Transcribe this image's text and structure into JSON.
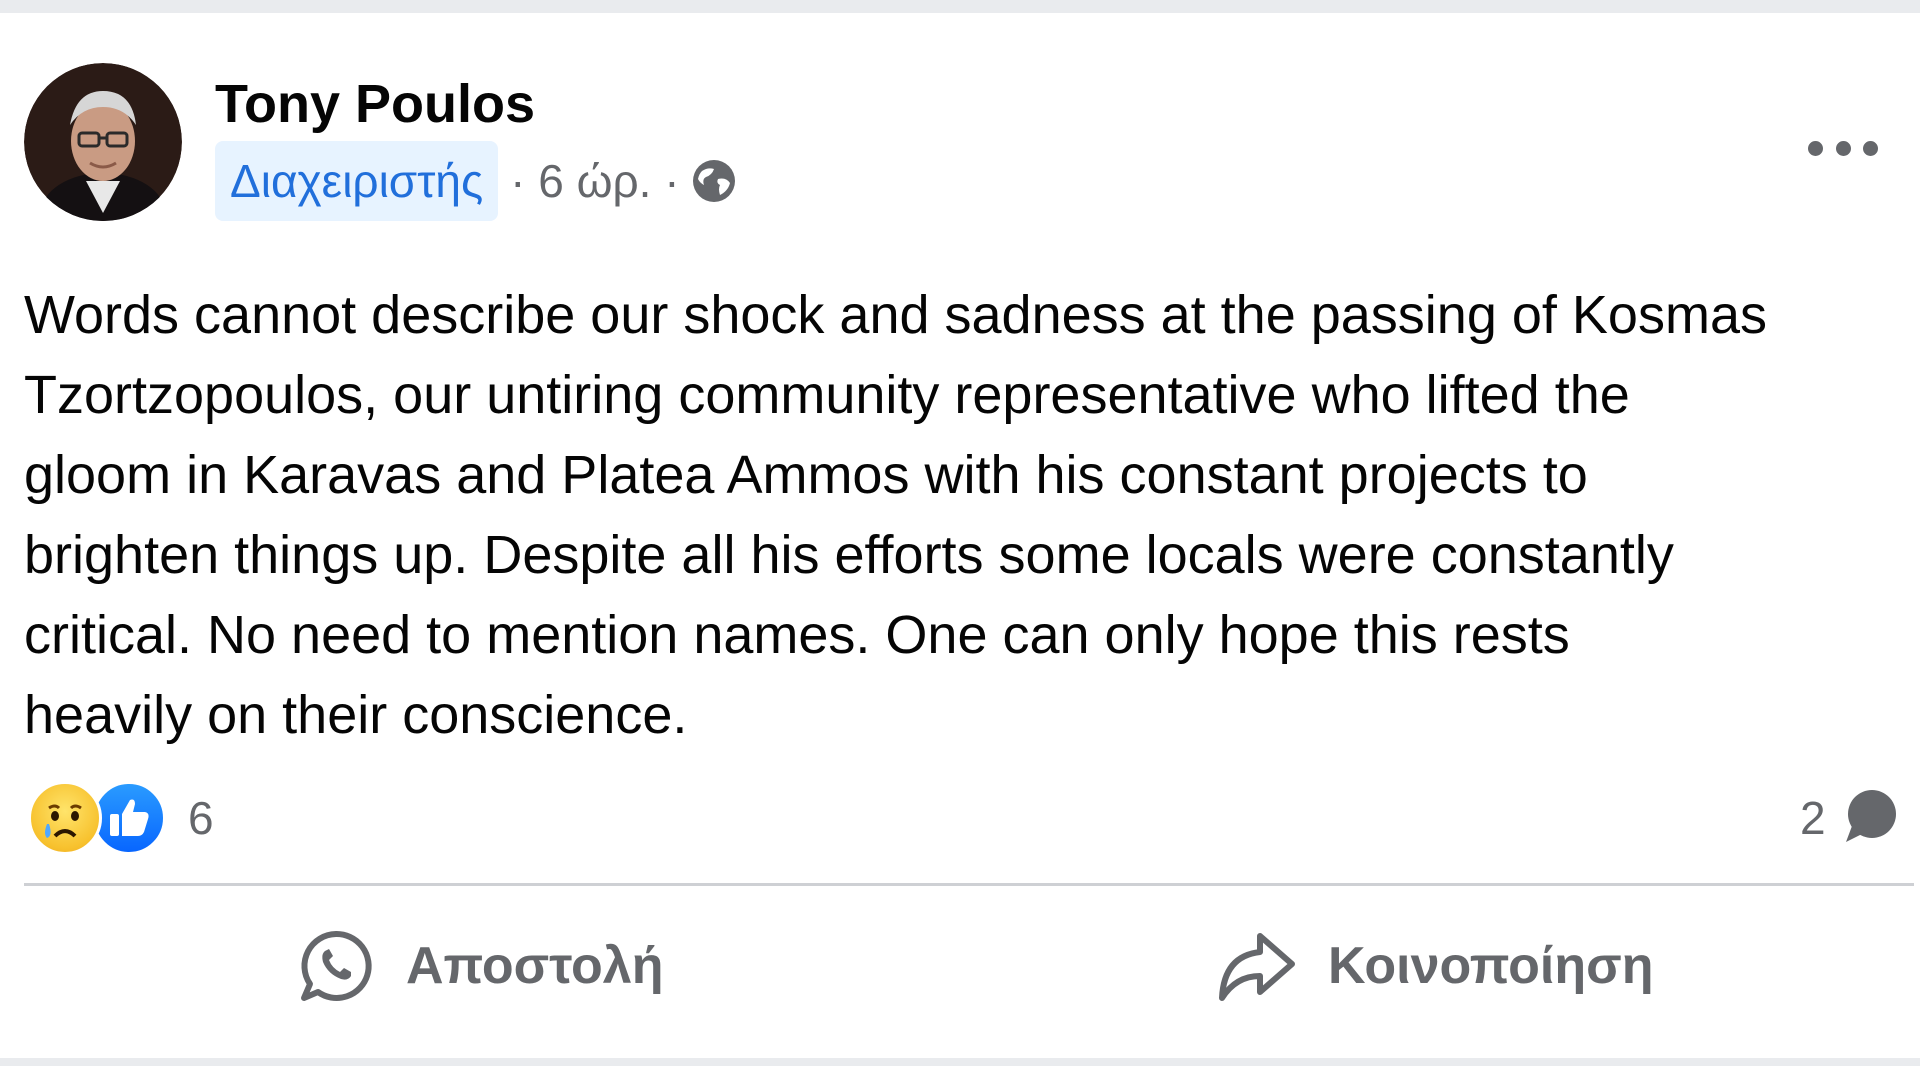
{
  "post": {
    "author": "Tony Poulos",
    "role_badge": "Διαχειριστής",
    "time_text": "· 6 ώρ. ·",
    "body_lines": [
      "Words cannot describe our shock and sadness at the passing of Kosmas",
      "Tzortzopoulos, our untiring community representative who lifted the",
      "gloom in Karavas and Platea Ammos with his constant projects to",
      "brighten things up. Despite all his efforts some locals were constantly",
      "critical. No need to mention names. One can only hope this rests",
      "heavily on their conscience."
    ],
    "reaction_count": "6",
    "comment_count": "2"
  },
  "actions": {
    "send_label": "Αποστολή",
    "share_label": "Κοινοποίηση"
  },
  "icons": {
    "privacy": "globe-icon",
    "more": "more-options-icon",
    "reactions": [
      "sad-reaction-icon",
      "like-reaction-icon"
    ],
    "comment": "comment-icon",
    "send": "whatsapp-icon",
    "share": "share-arrow-icon"
  },
  "colors": {
    "badge_background": "#e7f3ff",
    "badge_text": "#216fdb",
    "like_blue": "#0866ff",
    "secondary_text": "#65676b"
  }
}
